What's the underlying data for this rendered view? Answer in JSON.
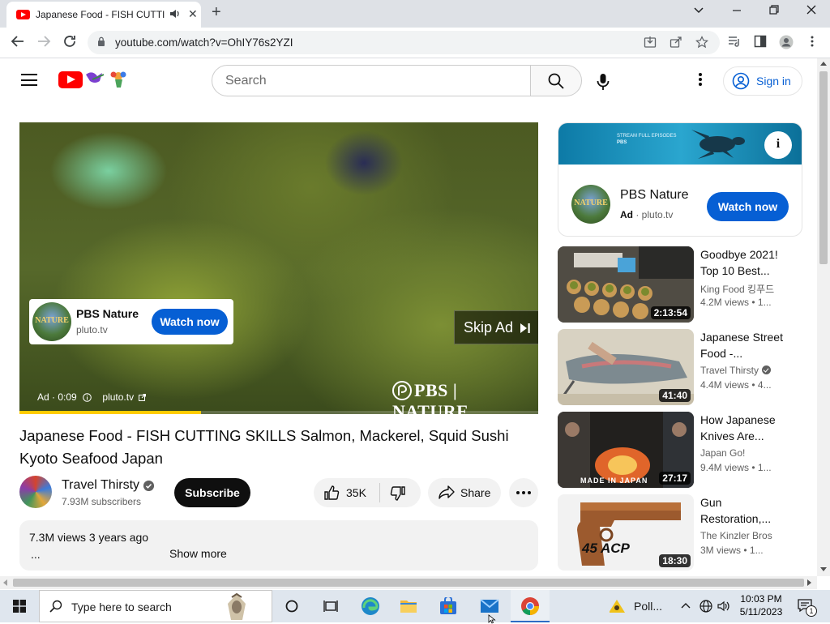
{
  "browser": {
    "tab_title": "Japanese Food - FISH CUTTING SKILLS Salmon, Mackerel, Squid Sushi Kyoto Seafood Japan - YouTube",
    "url": "youtube.com/watch?v=OhIY76s2YZI"
  },
  "youtube": {
    "search_placeholder": "Search",
    "sign_in": "Sign in"
  },
  "player": {
    "ad_card": {
      "name": "PBS Nature",
      "site": "pluto.tv",
      "button": "Watch now",
      "logo_text": "NATURE"
    },
    "skip_ad": "Skip Ad",
    "pbs_logo": "PBS | NATURE",
    "ad_label": "Ad · 0:09",
    "ad_site": "pluto.tv",
    "ad_progress": 0.35
  },
  "video": {
    "title": "Japanese Food - FISH CUTTING SKILLS Salmon, Mackerel, Squid Sushi Kyoto Seafood Japan",
    "channel": "Travel Thirsty",
    "subscribers": "7.93M subscribers",
    "subscribe": "Subscribe",
    "likes": "35K",
    "share": "Share",
    "views_age": "7.3M views  3 years ago",
    "desc_ellipsis": "...",
    "show_more": "Show more"
  },
  "side_ad": {
    "banner_text": "STREAM FULL EPISODES",
    "banner_brand": "PBS",
    "name": "PBS Nature",
    "ad": "Ad",
    "site": "· pluto.tv",
    "button": "Watch now",
    "logo_text": "NATURE"
  },
  "related": [
    {
      "title": "Goodbye 2021! Top 10 Best...",
      "channel": "King Food 킹푸드",
      "views": "4.2M views",
      "age": "• 1...",
      "duration": "2:13:54",
      "verified": false
    },
    {
      "title": "Japanese Street Food -...",
      "channel": "Travel Thirsty",
      "views": "4.4M views",
      "age": "• 4...",
      "duration": "41:40",
      "verified": true
    },
    {
      "title": "How Japanese Knives Are...",
      "channel": "Japan Go!",
      "views": "9.4M views",
      "age": "• 1...",
      "duration": "27:17",
      "verified": false,
      "thumb_text": "MADE IN JAPAN"
    },
    {
      "title": "Gun Restoration,...",
      "channel": "The Kinzler Bros",
      "views": "3M views",
      "age": "• 1...",
      "duration": "18:30",
      "verified": false,
      "thumb_text": "45 ACP"
    }
  ],
  "taskbar": {
    "search_label": "Type here to search",
    "weather": "Poll...",
    "time": "10:03 PM",
    "date": "5/11/2023",
    "notifications": "1"
  }
}
